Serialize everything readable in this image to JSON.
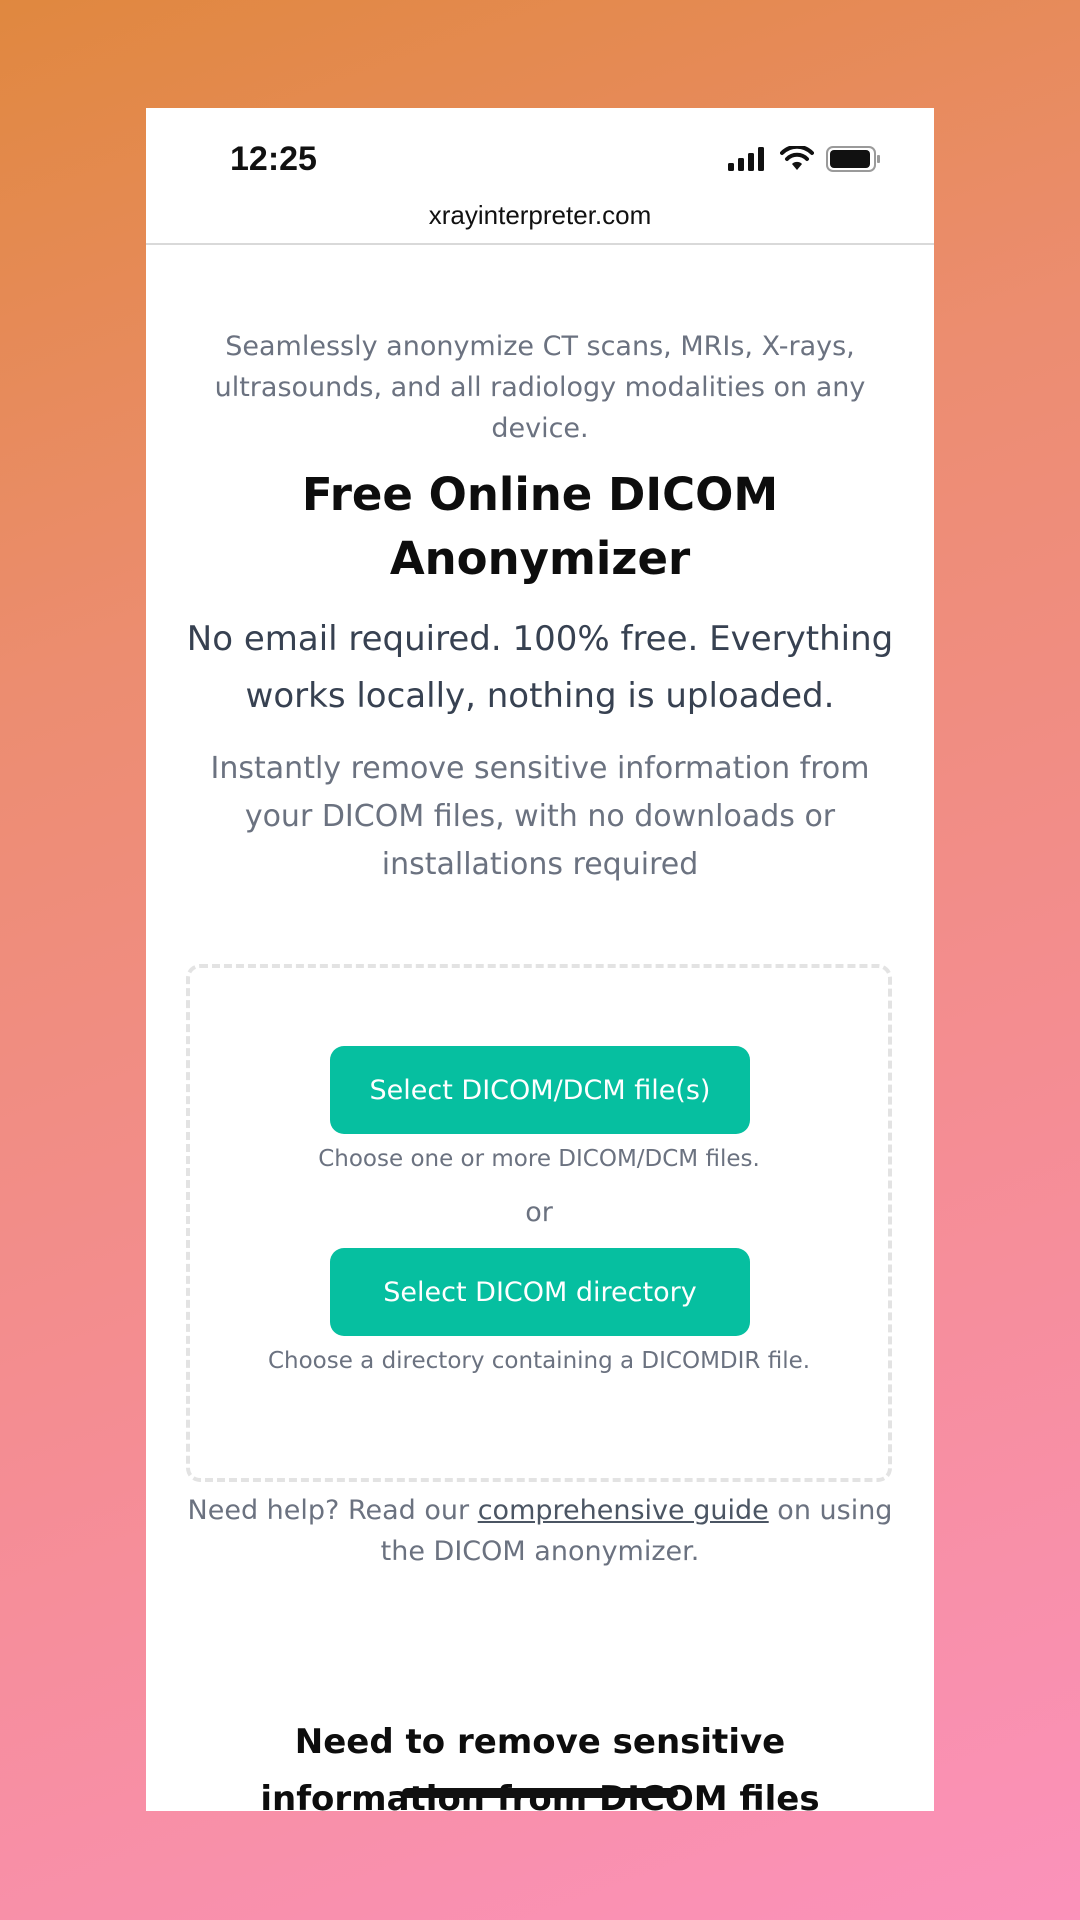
{
  "status_bar": {
    "time": "12:25",
    "icons": [
      "signal-icon",
      "wifi-icon",
      "battery-icon"
    ]
  },
  "browser": {
    "url": "xrayinterpreter.com"
  },
  "page": {
    "intro": "Seamlessly anonymize CT scans, MRIs, X-rays, ultrasounds, and all radiology modalities on any device.",
    "title": "Free Online DICOM Anonymizer",
    "subtitle": "No email required. 100% free. Everything works locally, nothing is uploaded.",
    "description": "Instantly remove sensitive information from your DICOM files, with no downloads or installations required",
    "upload": {
      "select_files_label": "Select DICOM/DCM file(s)",
      "select_files_hint": "Choose one or more DICOM/DCM files.",
      "or_label": "or",
      "select_directory_label": "Select DICOM directory",
      "select_directory_hint": "Choose a directory containing a DICOMDIR file."
    },
    "help": {
      "prefix": "Need help? Read our ",
      "link_text": "comprehensive guide",
      "suffix": " on using the DICOM anonymizer."
    },
    "section_title": "Need to remove sensitive information from DICOM files before"
  },
  "colors": {
    "accent": "#06bfa0",
    "text_muted": "#6b7280",
    "text_dark": "#0d0d0d"
  }
}
